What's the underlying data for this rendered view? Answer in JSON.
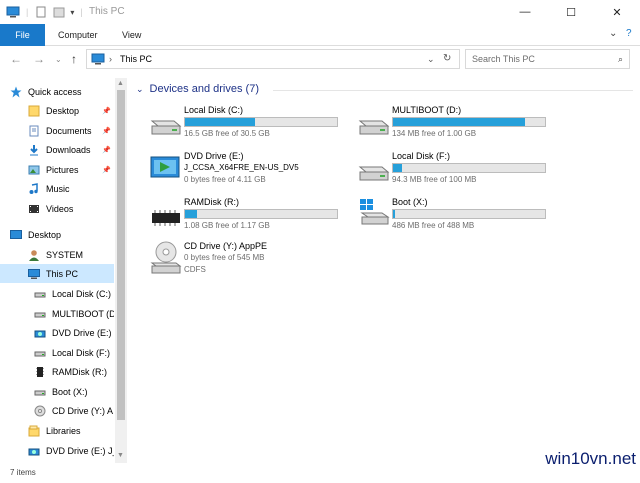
{
  "window": {
    "title": "This PC",
    "controls": {
      "minimize": "—",
      "maximize": "☐",
      "close": "✕"
    }
  },
  "ribbon": {
    "tabs": [
      "File",
      "Computer",
      "View"
    ],
    "help_icon": "?"
  },
  "address": {
    "path": [
      "This PC"
    ],
    "search_placeholder": "Search This PC"
  },
  "navpane": {
    "items": [
      {
        "label": "Quick access",
        "icon": "star-icon",
        "level": 0
      },
      {
        "label": "Desktop",
        "icon": "folder-icon",
        "level": 1,
        "pinned": true
      },
      {
        "label": "Documents",
        "icon": "documents-icon",
        "level": 1,
        "pinned": true
      },
      {
        "label": "Downloads",
        "icon": "download-icon",
        "level": 1,
        "pinned": true
      },
      {
        "label": "Pictures",
        "icon": "pictures-icon",
        "level": 1,
        "pinned": true
      },
      {
        "label": "Music",
        "icon": "music-icon",
        "level": 1
      },
      {
        "label": "Videos",
        "icon": "videos-icon",
        "level": 1
      },
      {
        "label": "Desktop",
        "icon": "desktop-icon",
        "level": 0
      },
      {
        "label": "SYSTEM",
        "icon": "user-icon",
        "level": 1
      },
      {
        "label": "This PC",
        "icon": "pc-icon",
        "level": 1,
        "selected": true
      },
      {
        "label": "Local Disk (C:)",
        "icon": "drive-icon",
        "level": 2
      },
      {
        "label": "MULTIBOOT (D:)",
        "icon": "drive-icon",
        "level": 2
      },
      {
        "label": "DVD Drive (E:) J_",
        "icon": "dvd-icon",
        "level": 2
      },
      {
        "label": "Local Disk (F:)",
        "icon": "drive-icon",
        "level": 2
      },
      {
        "label": "RAMDisk (R:)",
        "icon": "ram-icon",
        "level": 2
      },
      {
        "label": "Boot (X:)",
        "icon": "drive-icon",
        "level": 2
      },
      {
        "label": "CD Drive (Y:) A",
        "icon": "cd-icon",
        "level": 2
      },
      {
        "label": "Libraries",
        "icon": "libraries-icon",
        "level": 1
      },
      {
        "label": "DVD Drive (E:) J_",
        "icon": "dvd-icon",
        "level": 1
      }
    ]
  },
  "content": {
    "group_title": "Devices and drives (7)",
    "drives": [
      {
        "name": "Local Disk (C:)",
        "info": "16.5 GB free of 30.5 GB",
        "used_fraction": 0.46,
        "icon": "hdd-icon"
      },
      {
        "name": "MULTIBOOT (D:)",
        "info": "134 MB free of 1.00 GB",
        "used_fraction": 0.87,
        "icon": "hdd-icon"
      },
      {
        "name": "DVD Drive (E:)",
        "line2": "J_CCSA_X64FRE_EN-US_DV5",
        "line3": "0 bytes free of 4.11 GB",
        "icon": "dvd-drive-icon"
      },
      {
        "name": "Local Disk (F:)",
        "info": "94.3 MB free of 100 MB",
        "used_fraction": 0.06,
        "icon": "hdd-icon"
      },
      {
        "name": "RAMDisk (R:)",
        "info": "1.08 GB free of 1.17 GB",
        "used_fraction": 0.08,
        "icon": "ram-disk-icon"
      },
      {
        "name": "Boot (X:)",
        "info": "486 MB free of 488 MB",
        "used_fraction": 0.01,
        "icon": "windows-drive-icon"
      },
      {
        "name": "CD Drive (Y:) AppPE",
        "line2": "0 bytes free of 545 MB",
        "line3": "CDFS",
        "icon": "cd-drive-icon"
      }
    ]
  },
  "status": {
    "item_count": "7 items"
  },
  "watermark": "win10vn.net",
  "colors": {
    "accent": "#1979ca",
    "fill": "#26a0da",
    "group_header": "#1e3287",
    "selection": "#cce8ff"
  }
}
